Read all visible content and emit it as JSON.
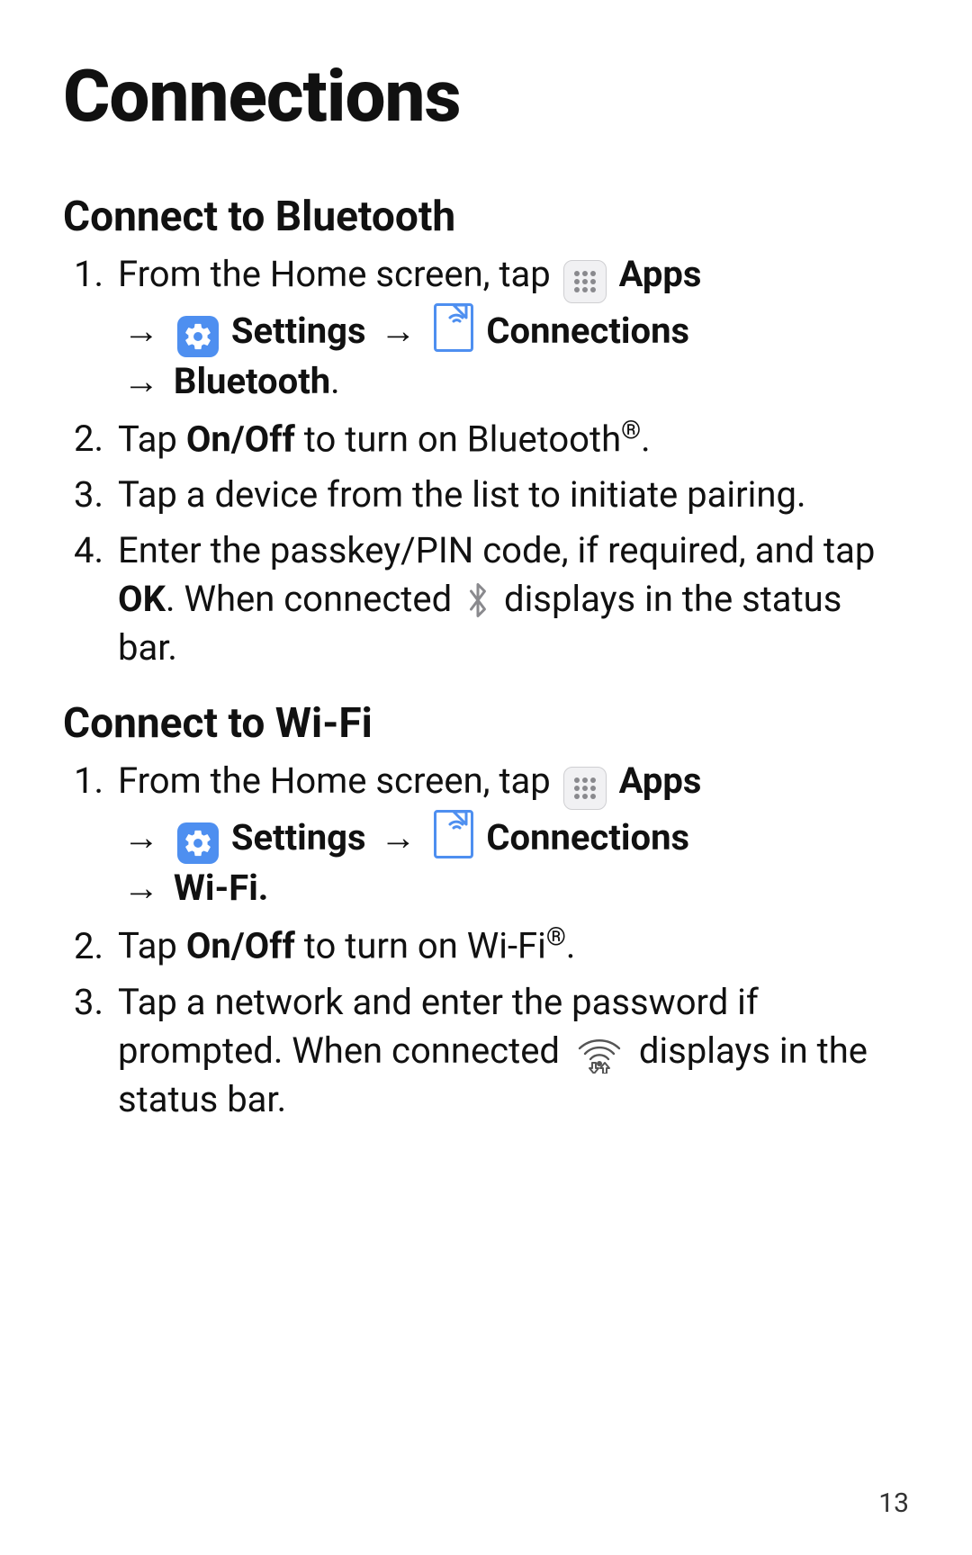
{
  "page": {
    "title": "Connections",
    "number": "13"
  },
  "labels": {
    "apps": "Apps",
    "settings": "Settings",
    "connections": "Connections",
    "bluetooth": "Bluetooth",
    "wifi": "Wi-Fi.",
    "onoff": "On/Off",
    "ok": "OK",
    "arrow": "→"
  },
  "bt": {
    "heading": "Connect to Bluetooth",
    "s1a": "From the Home screen, tap ",
    "s2a": "Tap ",
    "s2b": " to turn on Bluetooth",
    "s2c": ".",
    "s3": "Tap a device from the list to initiate pairing.",
    "s4a": "Enter the passkey/PIN code, if required, and tap ",
    "s4b": ". When connected ",
    "s4c": " displays in the status bar."
  },
  "wf": {
    "heading": "Connect to Wi-Fi",
    "s1a": "From the Home screen, tap ",
    "s2a": "Tap ",
    "s2b": " to turn on Wi-Fi",
    "s2c": ".",
    "s3a": "Tap a network and enter the password if prompted. When connected ",
    "s3b": " displays in the status bar."
  },
  "reg": "®"
}
